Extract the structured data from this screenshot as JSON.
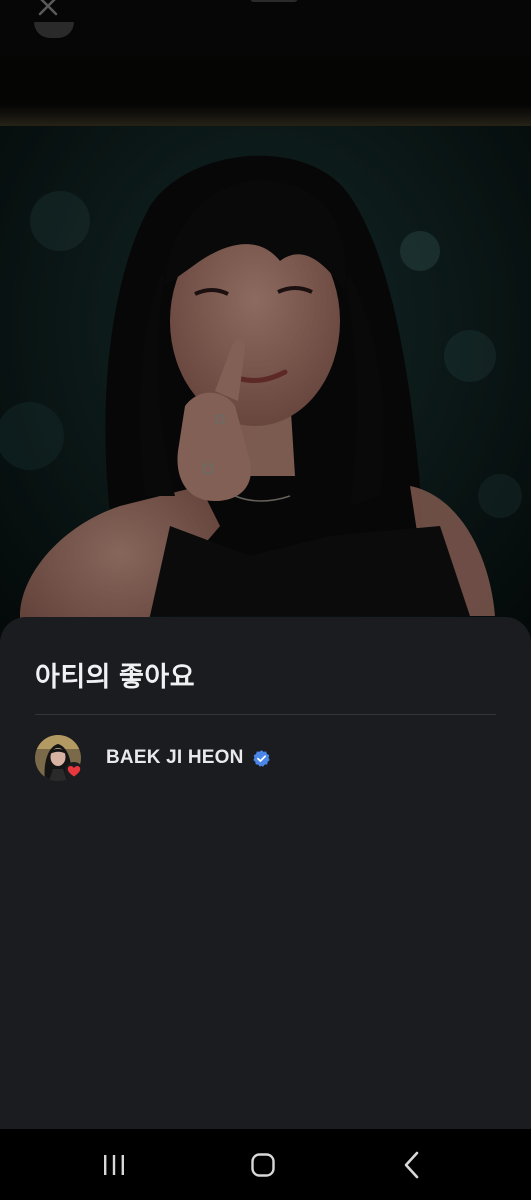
{
  "sheet": {
    "title": "아티의 좋아요"
  },
  "likes": [
    {
      "name": "BAEK JI HEON",
      "verified": true,
      "badge_icon": "heart-icon",
      "badge_color": "#e8383d"
    }
  ],
  "icons": {
    "close": "close-icon",
    "verified": "verified-check-icon",
    "nav_recents": "recents-icon",
    "nav_home": "home-icon",
    "nav_back": "back-icon"
  },
  "colors": {
    "sheet_bg": "#1b1c20",
    "verified_blue": "#4a86e8",
    "heart_red": "#e8383d"
  }
}
